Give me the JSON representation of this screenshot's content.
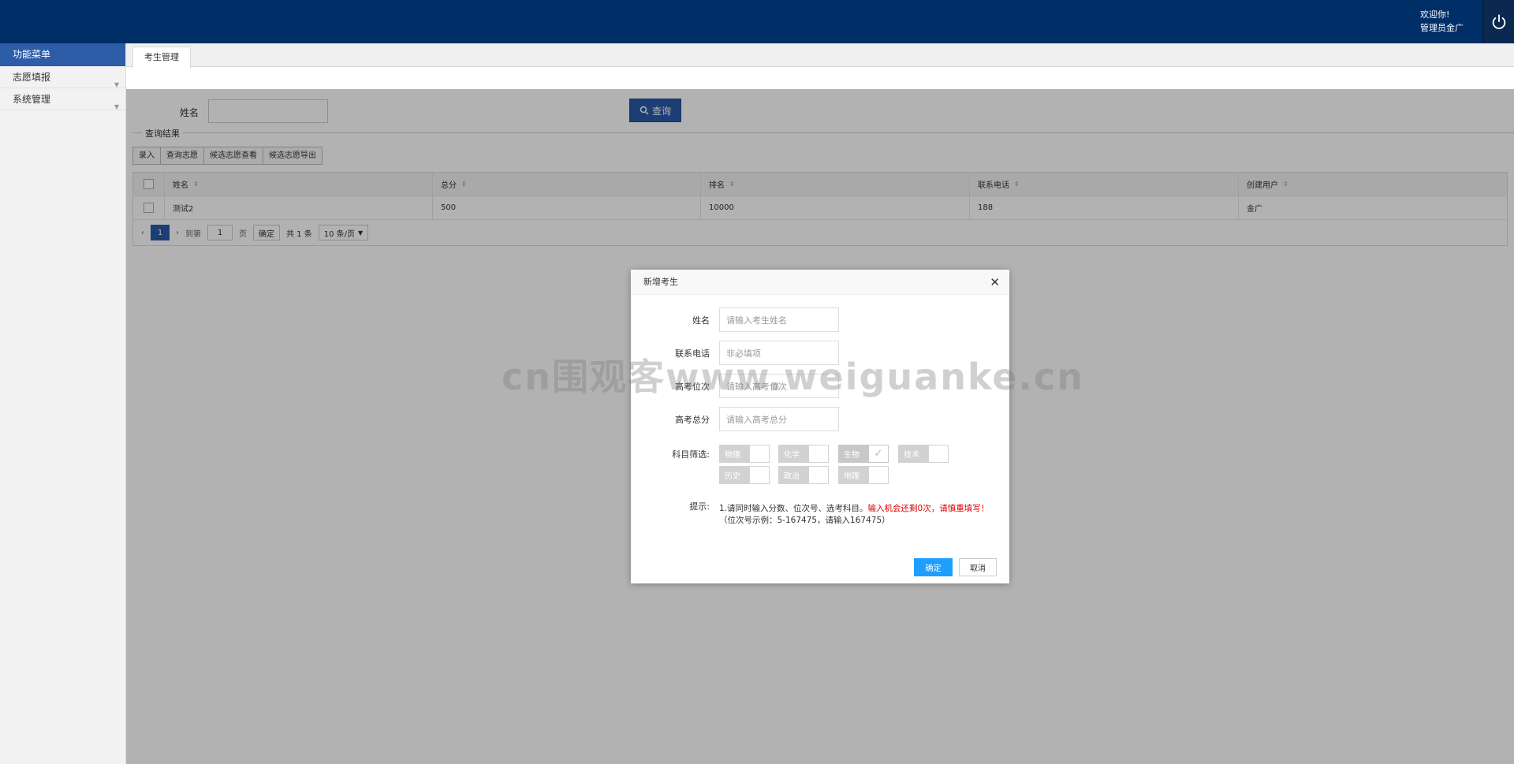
{
  "header": {
    "welcome_line1": "欢迎你!",
    "welcome_line2": "管理员金广",
    "power_icon": "power-icon"
  },
  "sidebar": {
    "title": "功能菜单",
    "items": [
      {
        "label": "志愿填报"
      },
      {
        "label": "系统管理"
      }
    ]
  },
  "tabs": [
    {
      "label": "考生管理"
    }
  ],
  "search": {
    "name_label": "姓名",
    "name_value": "",
    "button_label": "查询"
  },
  "results": {
    "section_title": "查询结果",
    "toolbar": [
      "录入",
      "查询志愿",
      "候选志愿查看",
      "候选志愿导出"
    ],
    "columns": [
      "姓名",
      "总分",
      "排名",
      "联系电话",
      "创建用户"
    ],
    "rows": [
      [
        "测试2",
        "500",
        "10000",
        "188",
        "金广"
      ]
    ],
    "pager": {
      "current_page": "1",
      "goto_label": "到第",
      "goto_value": "1",
      "page_unit": "页",
      "confirm_label": "确定",
      "total": "共 1 条",
      "page_size": "10 条/页"
    }
  },
  "modal": {
    "title": "新增考生",
    "fields": [
      {
        "label": "姓名",
        "placeholder": "请输入考生姓名"
      },
      {
        "label": "联系电话",
        "placeholder": "非必填项"
      },
      {
        "label": "高考位次",
        "placeholder": "请输入高考位次"
      },
      {
        "label": "高考总分",
        "placeholder": "请输入高考总分"
      }
    ],
    "subject_label": "科目筛选:",
    "subjects": [
      {
        "label": "物理",
        "checked": false
      },
      {
        "label": "化学",
        "checked": false
      },
      {
        "label": "生物",
        "checked": true
      },
      {
        "label": "技术",
        "checked": false
      },
      {
        "label": "历史",
        "checked": false
      },
      {
        "label": "政治",
        "checked": false
      },
      {
        "label": "地理",
        "checked": false
      }
    ],
    "hint_label": "提示:",
    "hint_part1": "1.请同时输入分数、位次号、选考科目。",
    "hint_red": "输入机会还剩0次，请慎重填写！",
    "hint_part2": "（位次号示例：5-167475，请输入167475）",
    "ok_label": "确定",
    "cancel_label": "取消"
  },
  "watermark": "cn围观客www.weiguanke.cn"
}
